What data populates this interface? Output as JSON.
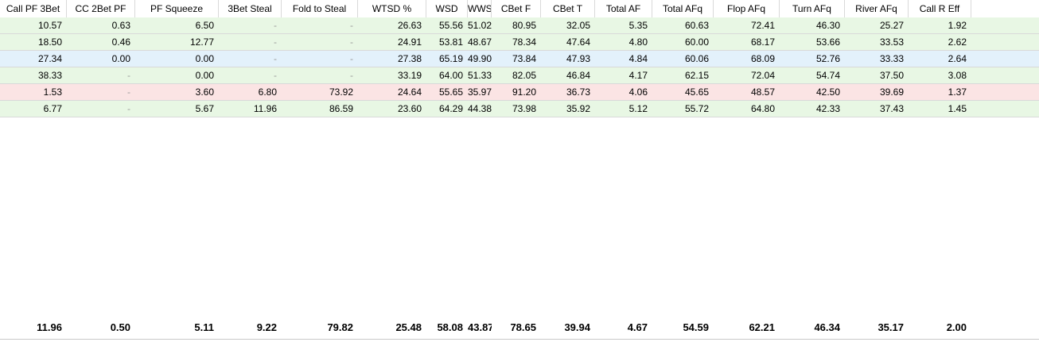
{
  "columns": [
    "Call PF 3Bet",
    "CC 2Bet PF",
    "PF Squeeze",
    "3Bet Steal",
    "Fold to Steal",
    "WTSD %",
    "WSD",
    "WWSF",
    "CBet F",
    "CBet T",
    "Total AF",
    "Total AFq",
    "Flop AFq",
    "Turn AFq",
    "River AFq",
    "Call R Eff"
  ],
  "rows": [
    {
      "bg": "#e8f7e4",
      "cells": [
        "10.57",
        "0.63",
        "6.50",
        "-",
        "-",
        "26.63",
        "55.56",
        "51.02",
        "80.95",
        "32.05",
        "5.35",
        "60.63",
        "72.41",
        "46.30",
        "25.27",
        "1.92"
      ]
    },
    {
      "bg": "#e8f7e4",
      "cells": [
        "18.50",
        "0.46",
        "12.77",
        "-",
        "-",
        "24.91",
        "53.81",
        "48.67",
        "78.34",
        "47.64",
        "4.80",
        "60.00",
        "68.17",
        "53.66",
        "33.53",
        "2.62"
      ]
    },
    {
      "bg": "#e3f1fb",
      "cells": [
        "27.34",
        "0.00",
        "0.00",
        "-",
        "-",
        "27.38",
        "65.19",
        "49.90",
        "73.84",
        "47.93",
        "4.84",
        "60.06",
        "68.09",
        "52.76",
        "33.33",
        "2.64"
      ]
    },
    {
      "bg": "#e8f7e4",
      "cells": [
        "38.33",
        "-",
        "0.00",
        "-",
        "-",
        "33.19",
        "64.00",
        "51.33",
        "82.05",
        "46.84",
        "4.17",
        "62.15",
        "72.04",
        "54.74",
        "37.50",
        "3.08"
      ]
    },
    {
      "bg": "#fbe4e4",
      "cells": [
        "1.53",
        "-",
        "3.60",
        "6.80",
        "73.92",
        "24.64",
        "55.65",
        "35.97",
        "91.20",
        "36.73",
        "4.06",
        "45.65",
        "48.57",
        "42.50",
        "39.69",
        "1.37"
      ]
    },
    {
      "bg": "#e8f7e4",
      "cells": [
        "6.77",
        "-",
        "5.67",
        "11.96",
        "86.59",
        "23.60",
        "64.29",
        "44.38",
        "73.98",
        "35.92",
        "5.12",
        "55.72",
        "64.80",
        "42.33",
        "37.43",
        "1.45"
      ]
    }
  ],
  "totals": [
    "11.96",
    "0.50",
    "5.11",
    "9.22",
    "79.82",
    "25.48",
    "58.08",
    "43.87",
    "78.65",
    "39.94",
    "4.67",
    "54.59",
    "62.21",
    "46.34",
    "35.17",
    "2.00"
  ]
}
